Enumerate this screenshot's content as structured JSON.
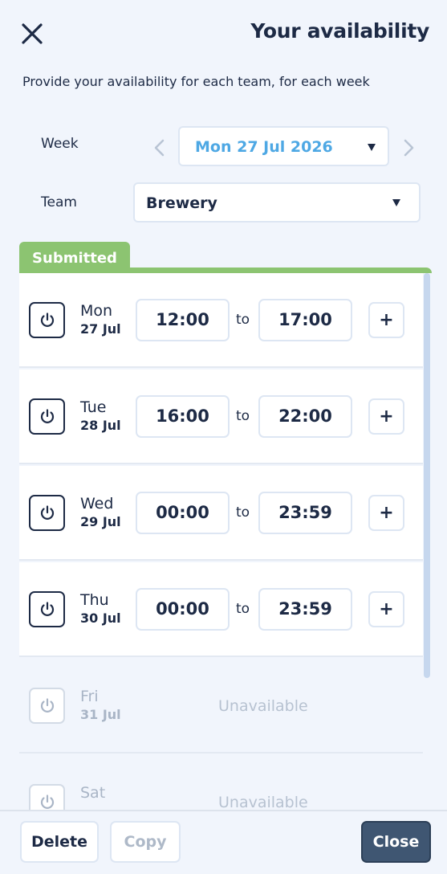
{
  "header": {
    "title": "Your availability",
    "subtitle": "Provide your availability for each team, for each week"
  },
  "filters": {
    "week_label": "Week",
    "week_value": "Mon 27 Jul 2026",
    "team_label": "Team",
    "team_value": "Brewery"
  },
  "status": {
    "label": "Submitted",
    "color": "#8cc471"
  },
  "days": [
    {
      "day": "Mon",
      "date": "27 Jul",
      "from": "12:00",
      "to_label": "to",
      "to": "17:00",
      "add": "+"
    },
    {
      "day": "Tue",
      "date": "28 Jul",
      "from": "16:00",
      "to_label": "to",
      "to": "22:00",
      "add": "+"
    },
    {
      "day": "Wed",
      "date": "29 Jul",
      "from": "00:00",
      "to_label": "to",
      "to": "23:59",
      "add": "+"
    },
    {
      "day": "Thu",
      "date": "30 Jul",
      "from": "00:00",
      "to_label": "to",
      "to": "23:59",
      "add": "+"
    },
    {
      "day": "Fri",
      "date": "31 Jul",
      "status": "Unavailable"
    },
    {
      "day": "Sat",
      "date": "",
      "status": "Unavailable"
    }
  ],
  "footer": {
    "delete_label": "Delete",
    "copy_label": "Copy",
    "close_label": "Close"
  },
  "icons": {
    "close": "close-icon",
    "prev": "chevron-left-icon",
    "next": "chevron-right-icon",
    "dropdown": "caret-down-icon",
    "power": "power-icon"
  },
  "colors": {
    "accent_blue": "#4ea8e4",
    "text_dark": "#1d2a45",
    "close_button": "#3f5672",
    "background": "#f1f5fc"
  }
}
